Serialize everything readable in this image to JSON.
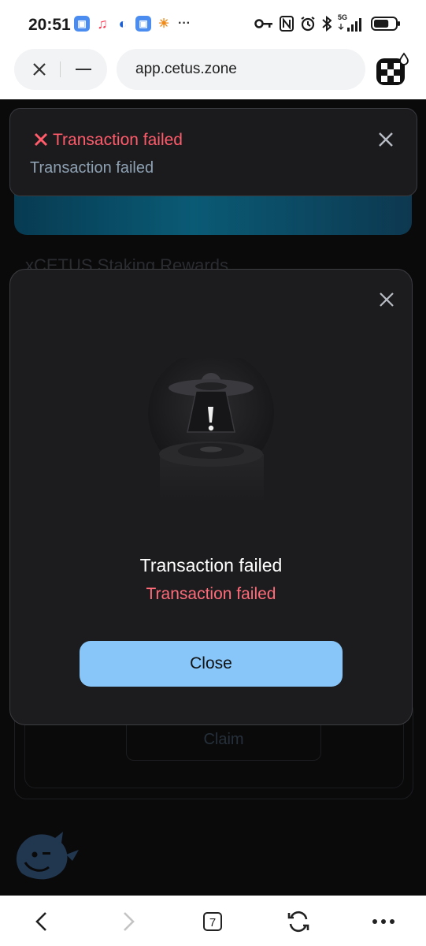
{
  "status_bar": {
    "time": "20:51",
    "network_label": "5G",
    "battery_level": 0.7
  },
  "browser": {
    "url": "app.cetus.zone"
  },
  "background": {
    "heading": "xCETUS Staking Rewards",
    "claim_label": "Claim"
  },
  "toast": {
    "title": "Transaction failed",
    "message": "Transaction failed"
  },
  "modal": {
    "title": "Transaction failed",
    "subtitle": "Transaction failed",
    "button_label": "Close"
  },
  "bottom_nav": {
    "tab_count": "7"
  },
  "colors": {
    "error": "#ff5b6b",
    "primary_button": "#88c6f9",
    "modal_bg": "#1c1c1e"
  },
  "icons": [
    "close-icon",
    "minus-icon",
    "wallet-extension-icon",
    "error-x-icon",
    "failed-transaction-illustration",
    "back-icon",
    "forward-icon",
    "refresh-icon",
    "more-icon"
  ]
}
